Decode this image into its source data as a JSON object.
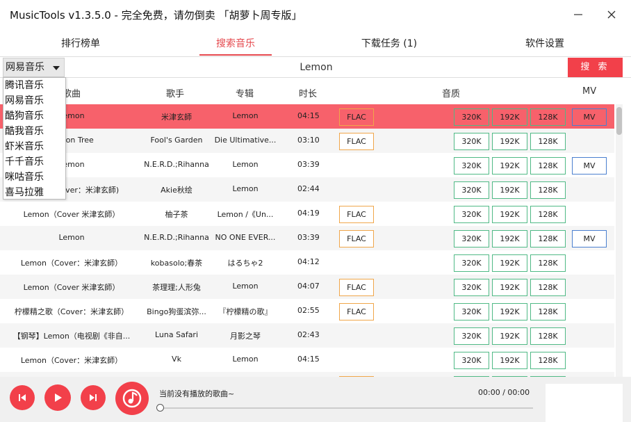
{
  "window": {
    "title": "MusicTools v1.3.5.0 - 完全免费，请勿倒卖 「胡萝卜周专版」"
  },
  "tabs": [
    {
      "label": "排行榜单"
    },
    {
      "label": "搜索音乐",
      "active": true
    },
    {
      "label": "下载任务 (1)"
    },
    {
      "label": "软件设置"
    }
  ],
  "search": {
    "source": "网易音乐",
    "query": "Lemon",
    "button": "搜 索"
  },
  "sources": [
    "腾讯音乐",
    "网易音乐",
    "酷狗音乐",
    "酷我音乐",
    "虾米音乐",
    "千千音乐",
    "咪咕音乐",
    "喜马拉雅"
  ],
  "columns": {
    "title": "歌曲",
    "artist": "歌手",
    "album": "专辑",
    "duration": "时长",
    "quality": "音质",
    "mv": "MV"
  },
  "quality_labels": {
    "flac": "FLAC",
    "q320": "320K",
    "q192": "192K",
    "q128": "128K",
    "mv": "MV"
  },
  "rows": [
    {
      "title": "Lemon",
      "artist": "米津玄師",
      "album": "Lemon",
      "duration": "04:15",
      "flac": true,
      "mv": true,
      "selected": true
    },
    {
      "title": "Lemon Tree",
      "artist": "Fool's Garden",
      "album": "Die Ultimative...",
      "duration": "03:10",
      "flac": true,
      "mv": false
    },
    {
      "title": "Lemon",
      "artist": "N.E.R.D.;Rihanna",
      "album": "Lemon",
      "duration": "03:39",
      "flac": false,
      "mv": true
    },
    {
      "title": "Lemon (Cover：米津玄師)",
      "artist": "Akie秋绘",
      "album": "Lemon",
      "duration": "02:44",
      "flac": false,
      "mv": false
    },
    {
      "title": "Lemon（Cover 米津玄師）",
      "artist": "柚子茶",
      "album": "Lemon /《Un...",
      "duration": "04:19",
      "flac": true,
      "mv": false
    },
    {
      "title": "Lemon",
      "artist": "N.E.R.D.;Rihanna",
      "album": "NO ONE EVER...",
      "duration": "03:39",
      "flac": true,
      "mv": true
    },
    {
      "title": "Lemon（Cover：米津玄師）",
      "artist": "kobasolo;春茶",
      "album": "はるちゃ2",
      "duration": "04:12",
      "flac": false,
      "mv": false
    },
    {
      "title": "Lemon（Cover 米津玄師）",
      "artist": "茶理理;人形兔",
      "album": "Lemon",
      "duration": "04:07",
      "flac": true,
      "mv": false
    },
    {
      "title": "柠檬精之歌（Cover：米津玄師）",
      "artist": "Bingo狗蛋滨弥...",
      "album": "『柠檬精の歌』",
      "duration": "02:55",
      "flac": true,
      "mv": false
    },
    {
      "title": "【钢琴】Lemon（电视剧《非自...",
      "artist": "Luna Safari",
      "album": "月影之琴",
      "duration": "02:43",
      "flac": false,
      "mv": false
    },
    {
      "title": "Lemon（Cover：米津玄師）",
      "artist": "Vk",
      "album": "Lemon",
      "duration": "04:15",
      "flac": false,
      "mv": false
    },
    {
      "title": "",
      "artist": "",
      "album": "",
      "duration": "",
      "flac": true,
      "mv": false
    }
  ],
  "player": {
    "now_playing": "当前没有播放的歌曲~",
    "time": "00:00 / 00:00",
    "progress": 0
  },
  "colors": {
    "accent": "#f2404a",
    "selected_row": "#f7616b",
    "flac_border": "#f0a64a",
    "quality_border": "#4fb985",
    "mv_border": "#4a7fcf"
  }
}
